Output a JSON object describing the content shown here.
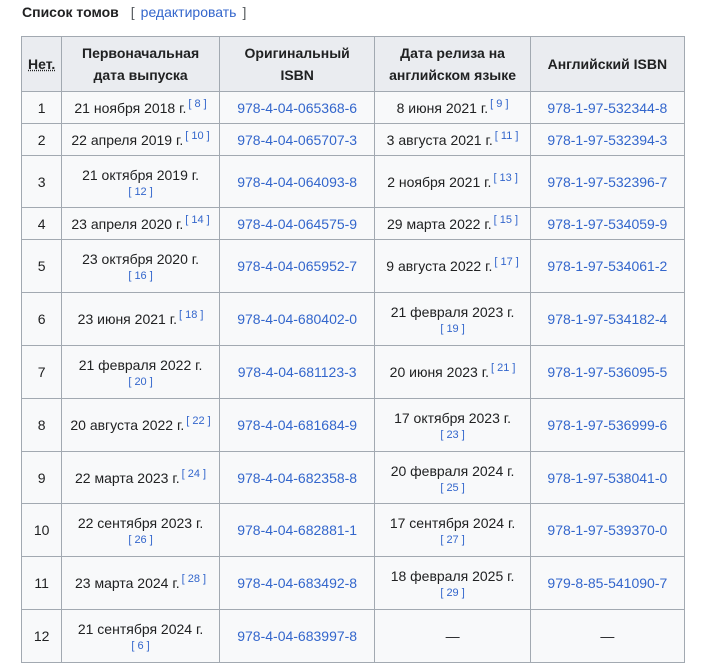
{
  "section": {
    "title": "Список томов",
    "edit_open": "[",
    "edit_label": "редактировать",
    "edit_close": "]"
  },
  "columns": {
    "num": "Нет.",
    "orig_date": "Первоначальная дата выпуска",
    "orig_isbn": "Оригинальный ISBN",
    "en_date": "Дата релиза на английском языке",
    "en_isbn": "Английский ISBN"
  },
  "rows": [
    {
      "num": "1",
      "orig_date": "21 ноября 2018 г.",
      "orig_ref": "[ 8 ]",
      "orig_wrap": false,
      "orig_isbn": "978-4-04-065368-6",
      "en_date": "8 июня 2021 г.",
      "en_ref": "[ 9 ]",
      "en_wrap": false,
      "en_isbn": "978-1-97-532344-8",
      "height": 32
    },
    {
      "num": "2",
      "orig_date": "22 апреля 2019 г.",
      "orig_ref": "[ 10 ]",
      "orig_wrap": false,
      "orig_isbn": "978-4-04-065707-3",
      "en_date": "3 августа 2021 г.",
      "en_ref": "[ 11 ]",
      "en_wrap": false,
      "en_isbn": "978-1-97-532394-3",
      "height": 32
    },
    {
      "num": "3",
      "orig_date": "21 октября 2019 г.",
      "orig_ref": "[ 12 ]",
      "orig_wrap": true,
      "orig_isbn": "978-4-04-064093-8",
      "en_date": "2 ноября 2021 г.",
      "en_ref": "[ 13 ]",
      "en_wrap": false,
      "en_isbn": "978-1-97-532396-7",
      "height": 52
    },
    {
      "num": "4",
      "orig_date": "23 апреля 2020 г.",
      "orig_ref": "[ 14 ]",
      "orig_wrap": false,
      "orig_isbn": "978-4-04-064575-9",
      "en_date": "29 марта 2022 г.",
      "en_ref": "[ 15 ]",
      "en_wrap": false,
      "en_isbn": "978-1-97-534059-9",
      "height": 32
    },
    {
      "num": "5",
      "orig_date": "23 октября 2020 г.",
      "orig_ref": "[ 16 ]",
      "orig_wrap": true,
      "orig_isbn": "978-4-04-065952-7",
      "en_date": "9 августа 2022 г.",
      "en_ref": "[ 17 ]",
      "en_wrap": false,
      "en_isbn": "978-1-97-534061-2",
      "height": 53
    },
    {
      "num": "6",
      "orig_date": "23 июня 2021 г.",
      "orig_ref": "[ 18 ]",
      "orig_wrap": false,
      "orig_isbn": "978-4-04-680402-0",
      "en_date": "21 февраля 2023 г.",
      "en_ref": "[ 19 ]",
      "en_wrap": true,
      "en_isbn": "978-1-97-534182-4",
      "height": 53
    },
    {
      "num": "7",
      "orig_date": "21 февраля 2022 г.",
      "orig_ref": "[ 20 ]",
      "orig_wrap": true,
      "orig_isbn": "978-4-04-681123-3",
      "en_date": "20 июня 2023 г.",
      "en_ref": "[ 21 ]",
      "en_wrap": false,
      "en_isbn": "978-1-97-536095-5",
      "height": 53
    },
    {
      "num": "8",
      "orig_date": "20 августа 2022 г.",
      "orig_ref": "[ 22 ]",
      "orig_wrap": false,
      "orig_isbn": "978-4-04-681684-9",
      "en_date": "17 октября 2023 г.",
      "en_ref": "[ 23 ]",
      "en_wrap": true,
      "en_isbn": "978-1-97-536999-6",
      "height": 53
    },
    {
      "num": "9",
      "orig_date": "22 марта 2023 г.",
      "orig_ref": "[ 24 ]",
      "orig_wrap": false,
      "orig_isbn": "978-4-04-682358-8",
      "en_date": "20 февраля 2024 г.",
      "en_ref": "[ 25 ]",
      "en_wrap": true,
      "en_isbn": "978-1-97-538041-0",
      "height": 52
    },
    {
      "num": "10",
      "orig_date": "22 сентября 2023 г.",
      "orig_ref": "[ 26 ]",
      "orig_wrap": true,
      "orig_isbn": "978-4-04-682881-1",
      "en_date": "17 сентября 2024 г.",
      "en_ref": "[ 27 ]",
      "en_wrap": true,
      "en_isbn": "978-1-97-539370-0",
      "height": 53
    },
    {
      "num": "11",
      "orig_date": "23 марта 2024 г.",
      "orig_ref": "[ 28 ]",
      "orig_wrap": false,
      "orig_isbn": "978-4-04-683492-8",
      "en_date": "18 февраля 2025 г.",
      "en_ref": "[ 29 ]",
      "en_wrap": true,
      "en_isbn": "979-8-85-541090-7",
      "height": 53
    },
    {
      "num": "12",
      "orig_date": "21 сентября 2024 г.",
      "orig_ref": "[ 6 ]",
      "orig_wrap": true,
      "orig_isbn": "978-4-04-683997-8",
      "en_date": "—",
      "en_ref": "",
      "en_wrap": false,
      "en_isbn": "—",
      "height": 53
    }
  ],
  "colors": {
    "link": "#3366cc",
    "header_bg": "#eaecf0",
    "cell_bg": "#f8f9fa",
    "border": "#a2a9b1"
  }
}
